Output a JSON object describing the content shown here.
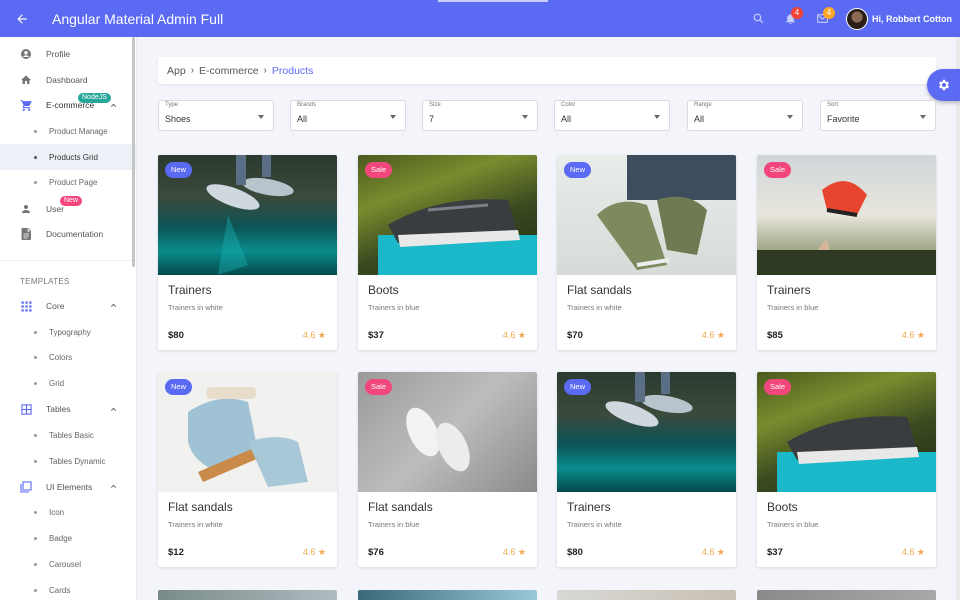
{
  "header": {
    "title": "Angular Material Admin Full",
    "notifications_count": "4",
    "messages_count": "4",
    "greeting": "Hi, Robbert Cotton"
  },
  "sidebar": {
    "items": [
      {
        "label": "Profile",
        "icon": "account-circle-icon"
      },
      {
        "label": "Dashboard",
        "icon": "home-icon"
      },
      {
        "label": "E-commerce",
        "icon": "cart-icon",
        "badge": "NodeJS"
      },
      {
        "label": "User",
        "icon": "person-icon",
        "badge": "New"
      },
      {
        "label": "Documentation",
        "icon": "document-icon"
      }
    ],
    "ecommerce_sub": [
      "Product Manage",
      "Products Grid",
      "Product Page"
    ],
    "templates_title": "TEMPLATES",
    "core": {
      "label": "Core",
      "sub": [
        "Typography",
        "Colors",
        "Grid"
      ]
    },
    "tables": {
      "label": "Tables",
      "sub": [
        "Tables Basic",
        "Tables Dynamic"
      ]
    },
    "ui_elements": {
      "label": "UI Elements",
      "sub": [
        "Icon",
        "Badge",
        "Carousel",
        "Cards"
      ]
    }
  },
  "breadcrumb": {
    "items": [
      "App",
      "E-commerce"
    ],
    "current": "Products"
  },
  "filters": [
    {
      "label": "Type",
      "value": "Shoes"
    },
    {
      "label": "Brands",
      "value": "All"
    },
    {
      "label": "Size",
      "value": "7"
    },
    {
      "label": "Color",
      "value": "All"
    },
    {
      "label": "Range",
      "value": "All"
    },
    {
      "label": "Sort",
      "value": "Favorite"
    }
  ],
  "products": [
    {
      "tag": "New",
      "name": "Trainers",
      "sub": "Trainers in white",
      "price": "$80",
      "rating": "4.6"
    },
    {
      "tag": "Sale",
      "name": "Boots",
      "sub": "Trainers in blue",
      "price": "$37",
      "rating": "4.6"
    },
    {
      "tag": "New",
      "name": "Flat sandals",
      "sub": "Trainers in white",
      "price": "$70",
      "rating": "4.6"
    },
    {
      "tag": "Sale",
      "name": "Trainers",
      "sub": "Trainers in blue",
      "price": "$85",
      "rating": "4.6"
    },
    {
      "tag": "New",
      "name": "Flat sandals",
      "sub": "Trainers in white",
      "price": "$12",
      "rating": "4.6"
    },
    {
      "tag": "Sale",
      "name": "Flat sandals",
      "sub": "Trainers in blue",
      "price": "$76",
      "rating": "4.6"
    },
    {
      "tag": "New",
      "name": "Trainers",
      "sub": "Trainers in white",
      "price": "$80",
      "rating": "4.6"
    },
    {
      "tag": "Sale",
      "name": "Boots",
      "sub": "Trainers in blue",
      "price": "$37",
      "rating": "4.6"
    }
  ],
  "colors": {
    "primary": "#5b6af3",
    "new_tag": "#5b6af3",
    "sale_tag": "#f2477d",
    "rating": "#f3a64a",
    "nodejs_badge": "#26a69a",
    "new_badge": "#f2477d"
  }
}
